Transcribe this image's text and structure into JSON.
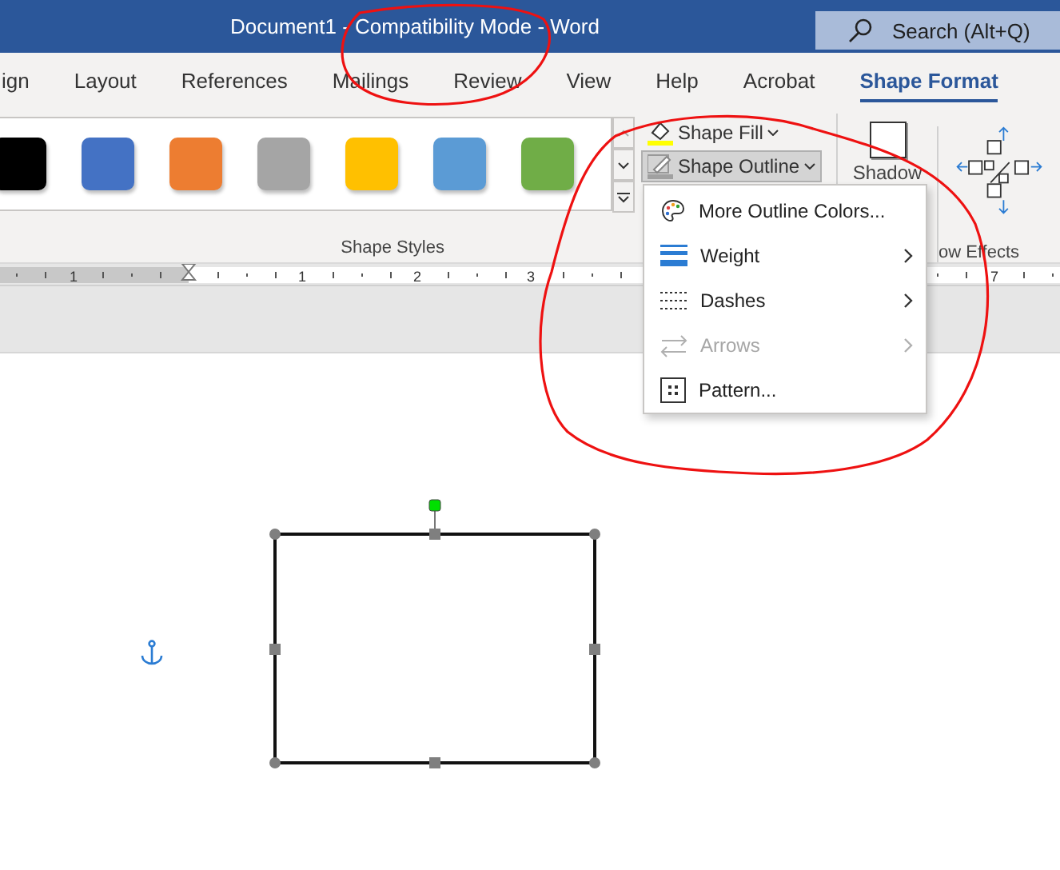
{
  "window": {
    "title": "Document1 - Compatibility Mode - Word",
    "search": {
      "placeholder": "Search (Alt+Q)"
    }
  },
  "tabs": [
    {
      "label": "ign",
      "selected": false
    },
    {
      "label": "Layout",
      "selected": false
    },
    {
      "label": "References",
      "selected": false
    },
    {
      "label": "Mailings",
      "selected": false
    },
    {
      "label": "Review",
      "selected": false
    },
    {
      "label": "View",
      "selected": false
    },
    {
      "label": "Help",
      "selected": false
    },
    {
      "label": "Acrobat",
      "selected": false
    },
    {
      "label": "Shape Format",
      "selected": true
    }
  ],
  "ribbon": {
    "style_swatches": [
      {
        "color": "#000000"
      },
      {
        "color": "#4472c4"
      },
      {
        "color": "#ed7d31"
      },
      {
        "color": "#a5a5a5"
      },
      {
        "color": "#ffc000"
      },
      {
        "color": "#5b9bd5"
      },
      {
        "color": "#70ad47"
      }
    ],
    "group_label": "Shape Styles",
    "shape_fill": {
      "label": "Shape Fill",
      "pressed": false
    },
    "shape_outline": {
      "label": "Shape Outline",
      "pressed": true
    },
    "shadow": "Shadow",
    "effects_label": "ow Effects"
  },
  "ruler": {
    "labels": [
      "1",
      "1",
      "2",
      "3",
      "7"
    ]
  },
  "menu": {
    "items": [
      {
        "label": "More Outline Colors...",
        "kind": "palette",
        "submenu": false,
        "disabled": false
      },
      {
        "label": "Weight",
        "kind": "weight",
        "submenu": true,
        "disabled": false
      },
      {
        "label": "Dashes",
        "kind": "dashes",
        "submenu": true,
        "disabled": false
      },
      {
        "label": "Arrows",
        "kind": "arrows",
        "submenu": true,
        "disabled": true
      },
      {
        "label": "Pattern...",
        "kind": "pattern",
        "submenu": false,
        "disabled": false
      }
    ]
  }
}
